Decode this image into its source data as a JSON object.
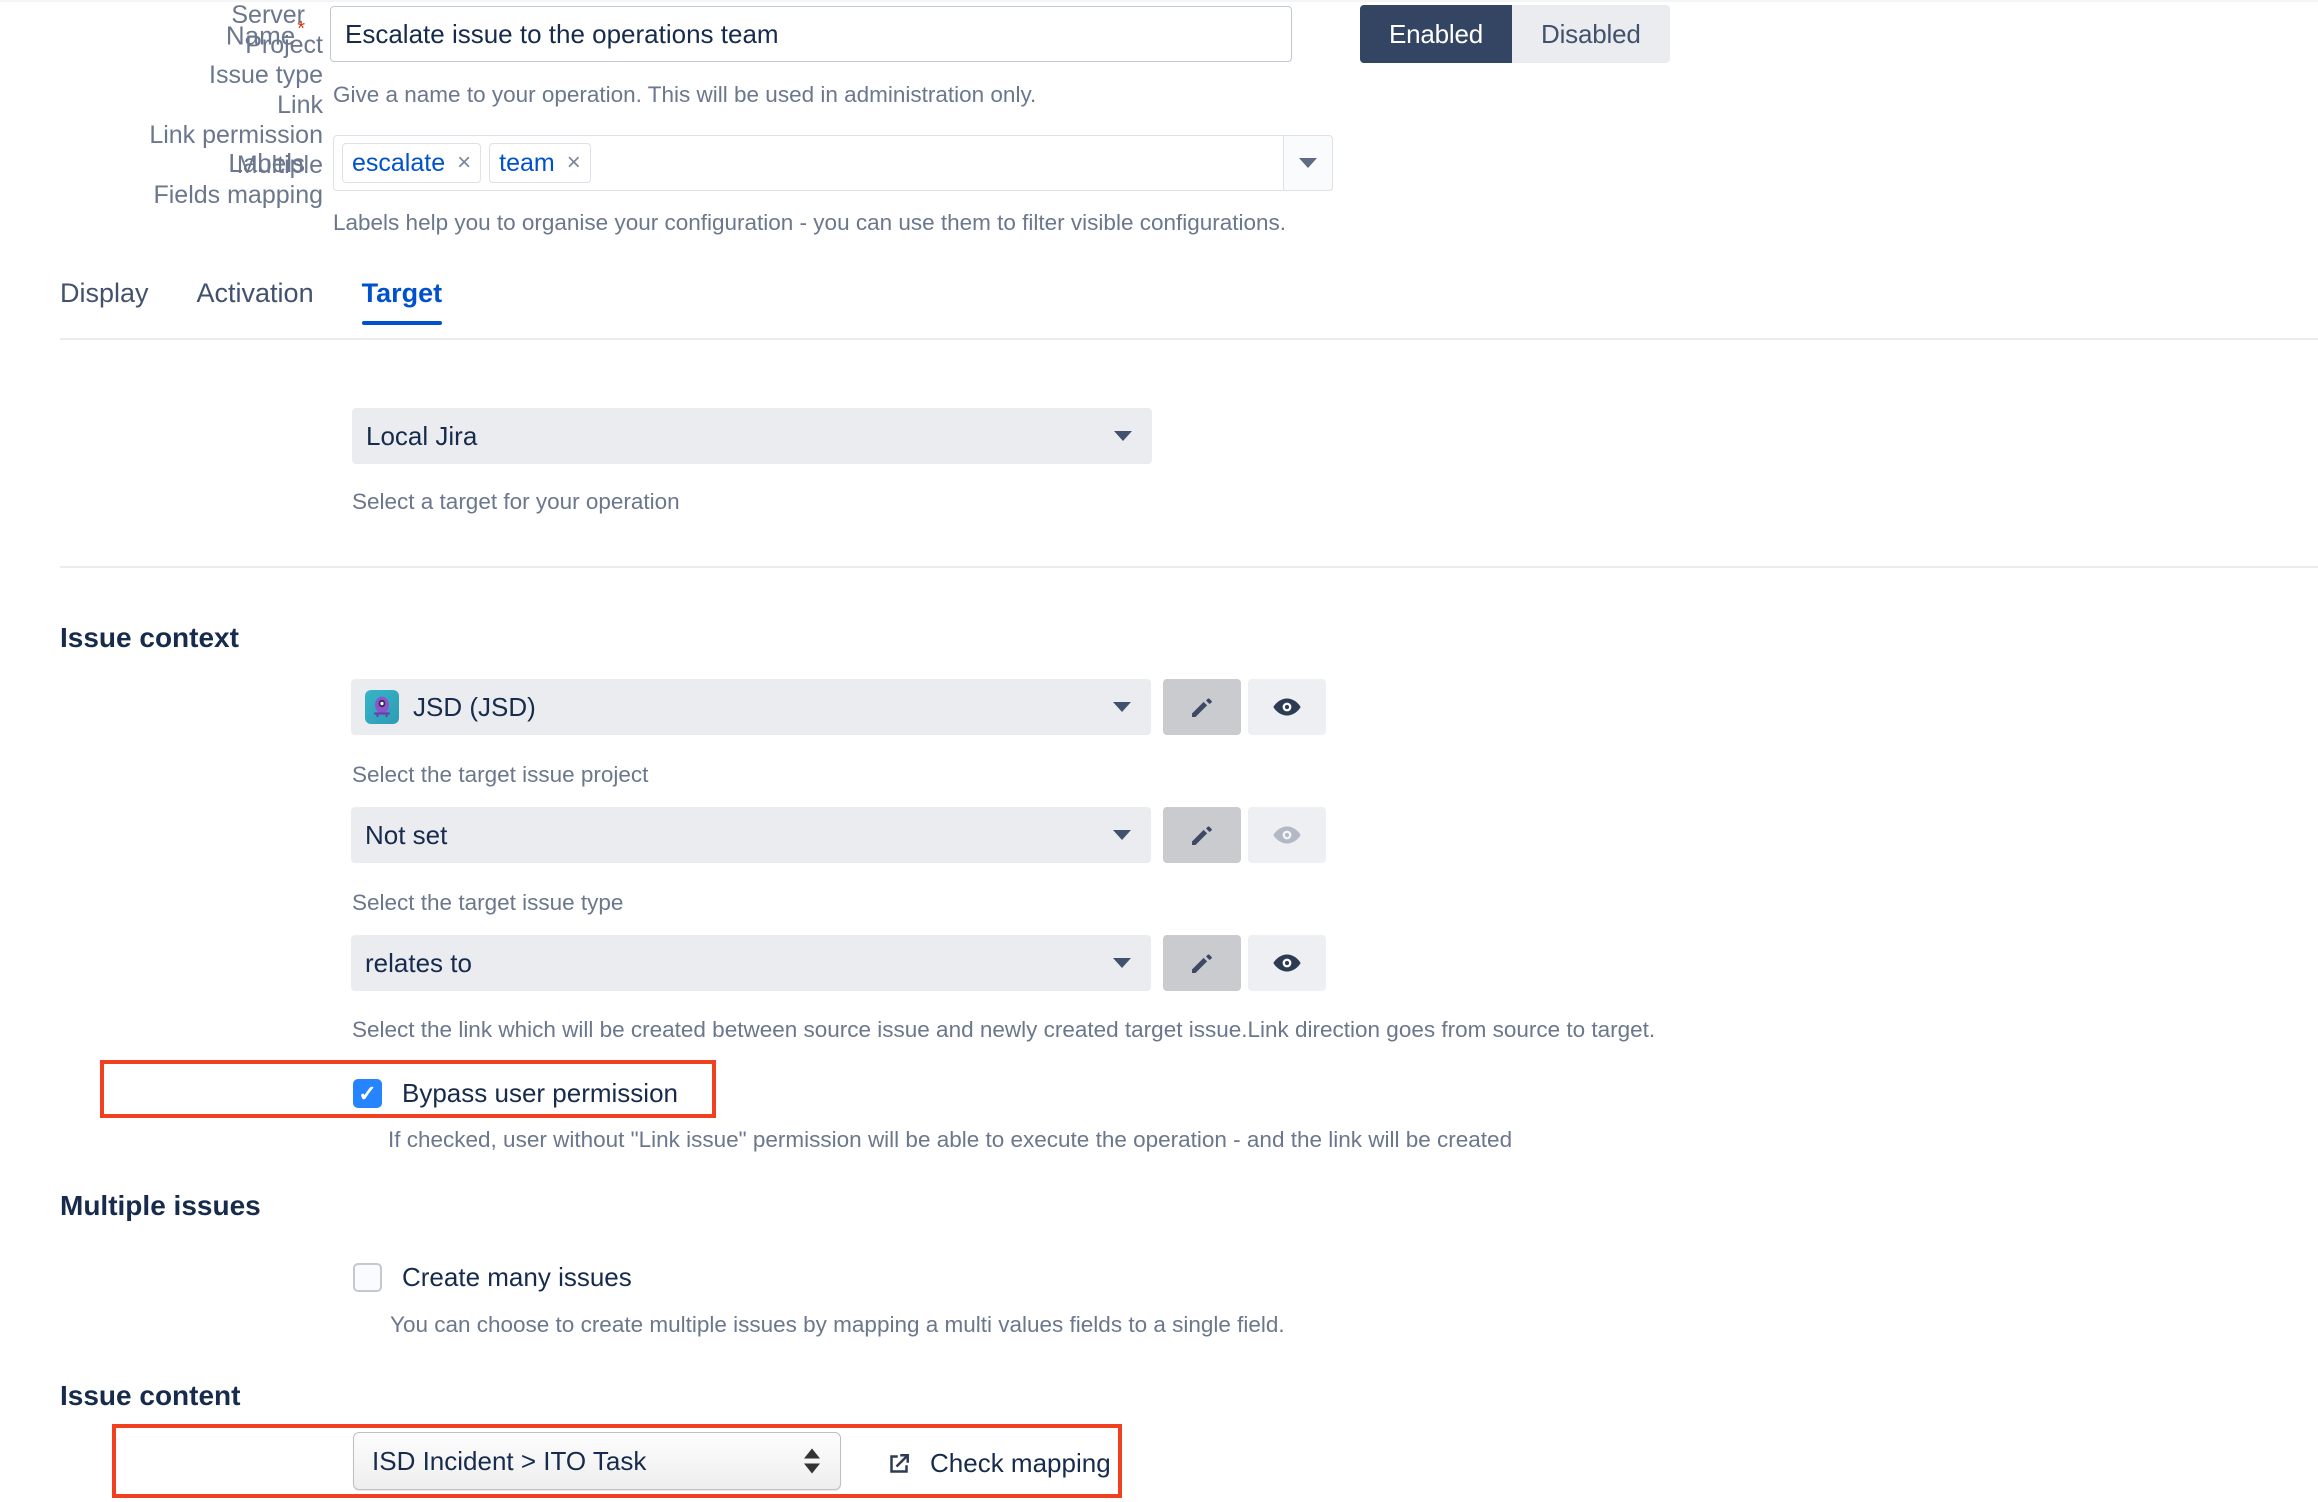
{
  "form": {
    "name": {
      "label": "Name",
      "required_marker": "*",
      "value": "Escalate issue to the operations team",
      "placeholder": "",
      "description": "Give a name to your operation. This will be used in administration only."
    },
    "status_toggle": {
      "enabled_label": "Enabled",
      "disabled_label": "Disabled",
      "selected": "Enabled"
    },
    "labels": {
      "label": "Labels",
      "chips": [
        {
          "text": "escalate",
          "remove": "×"
        },
        {
          "text": "team",
          "remove": "×"
        }
      ],
      "description": "Labels help you to organise your configuration - you can use them to filter visible configurations."
    }
  },
  "tabs": [
    {
      "label": "Display",
      "active": false
    },
    {
      "label": "Activation",
      "active": false
    },
    {
      "label": "Target",
      "active": true
    }
  ],
  "target": {
    "server": {
      "label": "Server",
      "value": "Local Jira",
      "description": "Select a target for your operation"
    },
    "issue_context": {
      "heading": "Issue context",
      "project": {
        "label": "Project",
        "value": "JSD (JSD)",
        "description": "Select the target issue project",
        "edit_icon": "pencil-icon",
        "preview_icon": "eye-icon"
      },
      "issue_type": {
        "label": "Issue type",
        "value": "Not set",
        "description": "Select the target issue type",
        "edit_icon": "pencil-icon",
        "preview_icon": "eye-icon-disabled"
      },
      "link": {
        "label": "Link",
        "value": "relates to",
        "description": "Select the link which will be created between source issue and newly created target issue.Link direction goes from source to target.",
        "edit_icon": "pencil-icon",
        "preview_icon": "eye-icon"
      },
      "link_permission": {
        "label": "Link permission",
        "checkbox_label": "Bypass user permission",
        "checked": true,
        "description": "If checked, user without \"Link issue\" permission will be able to execute the operation - and the link will be created"
      }
    },
    "multiple_issues": {
      "heading": "Multiple issues",
      "multiple": {
        "label": "Multiple",
        "checkbox_label": "Create many issues",
        "checked": false,
        "description": "You can choose to create multiple issues by mapping a multi values fields to a single field."
      }
    },
    "issue_content": {
      "heading": "Issue content",
      "fields_mapping": {
        "label": "Fields mapping",
        "value": "ISD Incident > ITO Task",
        "check_mapping_label": "Check mapping",
        "check_mapping_icon": "external-link-icon"
      }
    }
  },
  "annotations": {
    "highlight_color": "#F04020",
    "accent_color": "#0052CC",
    "checkbox_color": "#2684FF"
  }
}
